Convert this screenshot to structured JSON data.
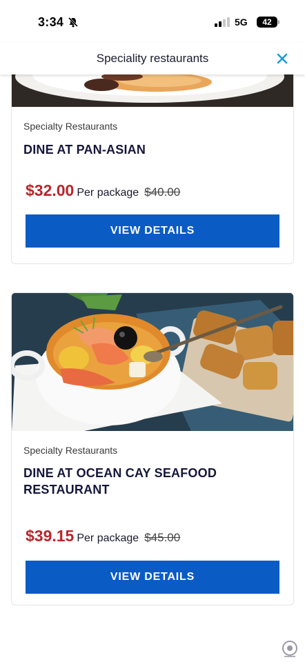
{
  "status_bar": {
    "time": "3:34",
    "network": "5G",
    "battery": "42"
  },
  "header": {
    "title": "Speciality restaurants",
    "close_icon": "close-icon",
    "accent_color": "#1a9bd7"
  },
  "cards": [
    {
      "category": "Specialty Restaurants",
      "title": "DINE AT PAN-ASIAN",
      "price": "$32.00",
      "price_unit": "Per package",
      "original_price": "$40.00",
      "button_label": "VIEW DETAILS"
    },
    {
      "category": "Specialty Restaurants",
      "title": "DINE AT OCEAN CAY SEAFOOD RESTAURANT",
      "price": "$39.15",
      "price_unit": "Per package",
      "original_price": "$45.00",
      "button_label": "VIEW DETAILS"
    }
  ],
  "colors": {
    "price": "#b8262b",
    "button": "#0a5bc4",
    "title": "#15163a"
  }
}
